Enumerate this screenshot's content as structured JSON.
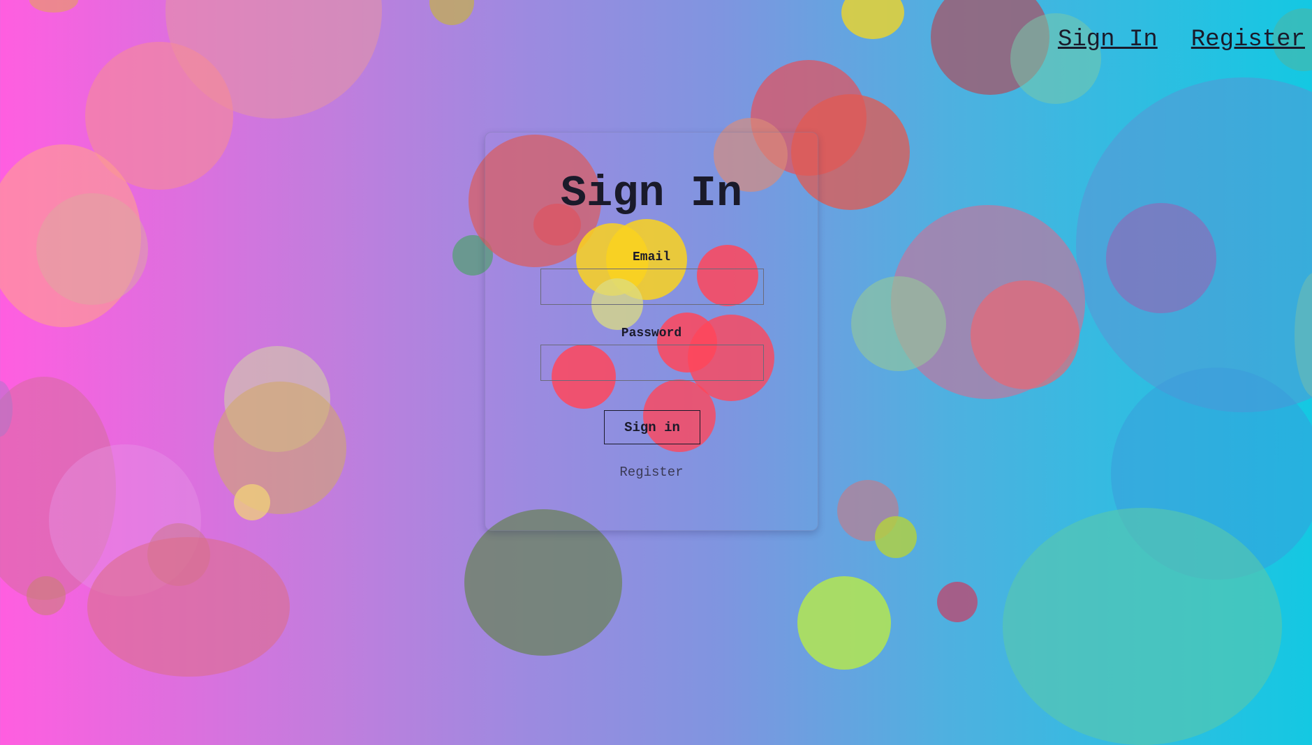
{
  "nav": {
    "sign_in": "Sign In",
    "register": "Register"
  },
  "form": {
    "title": "Sign In",
    "email_label": "Email",
    "email_value": "",
    "password_label": "Password",
    "password_value": "",
    "submit_label": "Sign in",
    "register_link": "Register"
  }
}
